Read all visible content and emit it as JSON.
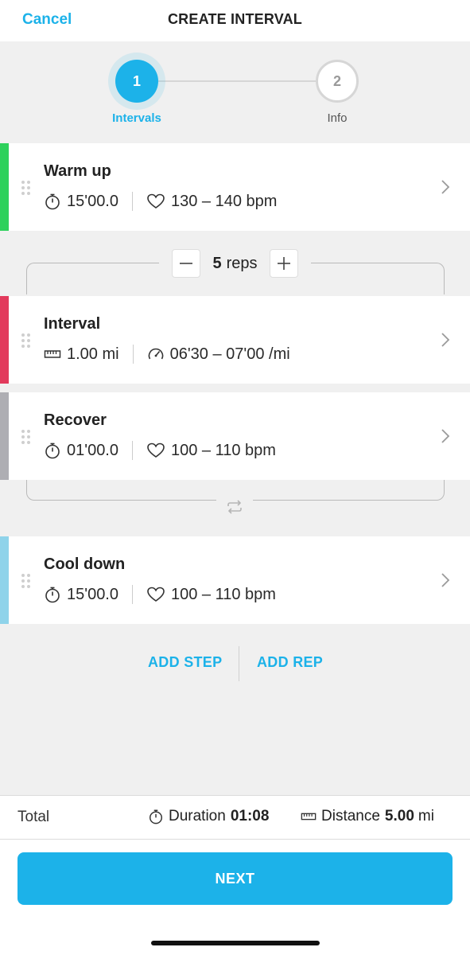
{
  "colors": {
    "accent": "#1cb2e9",
    "warmup": "#2dd15b",
    "interval": "#e23a5c",
    "recover": "#aeaeb3",
    "cooldown": "#8fd3ea"
  },
  "header": {
    "cancel": "Cancel",
    "title": "CREATE INTERVAL"
  },
  "stepper": {
    "step1_num": "1",
    "step1_label": "Intervals",
    "step2_num": "2",
    "step2_label": "Info"
  },
  "steps": [
    {
      "title": "Warm up",
      "left_icon": "stopwatch-icon",
      "left_value": "15'00.0",
      "right_icon": "heart-icon",
      "right_value": "130 – 140 bpm"
    },
    {
      "title": "Interval",
      "left_icon": "ruler-icon",
      "left_value": "1.00 mi",
      "right_icon": "speedometer-icon",
      "right_value": "06'30 – 07'00 /mi"
    },
    {
      "title": "Recover",
      "left_icon": "stopwatch-icon",
      "left_value": "01'00.0",
      "right_icon": "heart-icon",
      "right_value": "100 – 110 bpm"
    },
    {
      "title": "Cool down",
      "left_icon": "stopwatch-icon",
      "left_value": "15'00.0",
      "right_icon": "heart-icon",
      "right_value": "100 – 110 bpm"
    }
  ],
  "repeat": {
    "count": "5",
    "unit": "reps"
  },
  "actions": {
    "add_step": "ADD STEP",
    "add_rep": "ADD REP"
  },
  "total": {
    "label": "Total",
    "duration_label": "Duration",
    "duration_value": "01:08",
    "distance_label": "Distance",
    "distance_value": "5.00",
    "distance_unit": "mi"
  },
  "footer": {
    "next": "NEXT"
  }
}
